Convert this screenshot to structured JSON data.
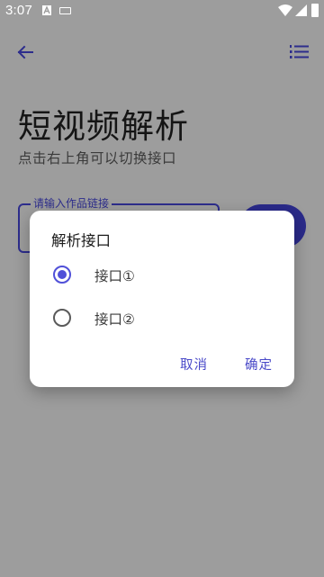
{
  "status_bar": {
    "time": "3:07",
    "icons": [
      "a-notification-icon",
      "keyboard-icon",
      "wifi-icon",
      "signal-icon",
      "battery-icon"
    ]
  },
  "app_bar": {
    "back_icon": "arrow-left-icon",
    "menu_icon": "list-numbered-icon",
    "accent_color": "#2d2d8c"
  },
  "page": {
    "title": "短视频解析",
    "subtitle": "点击右上角可以切换接口",
    "link_input_label": "请输入作品链接"
  },
  "dialog": {
    "title": "解析接口",
    "options": [
      {
        "label": "接口①",
        "selected": true
      },
      {
        "label": "接口②",
        "selected": false
      }
    ],
    "cancel_label": "取消",
    "confirm_label": "确定",
    "accent_color": "#5050d8"
  }
}
